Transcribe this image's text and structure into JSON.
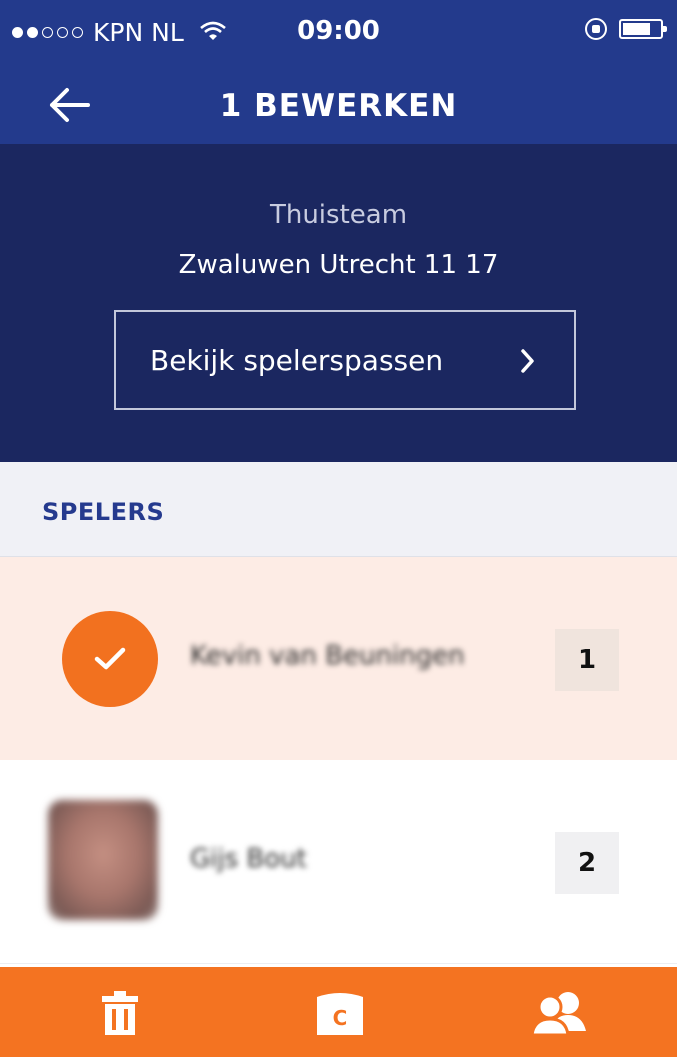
{
  "status_bar": {
    "carrier": "KPN NL",
    "time": "09:00",
    "signal_bars_filled": 2,
    "signal_bars_total": 5
  },
  "nav": {
    "title": "1 BEWERKEN",
    "back_icon": "arrow-left-icon"
  },
  "team": {
    "label": "Thuisteam",
    "name": "Zwaluwen Utrecht 11 17",
    "passes_button": "Bekijk spelerspassen"
  },
  "section": {
    "title": "SPELERS"
  },
  "players": [
    {
      "name": "Kevin van Beuningen",
      "number": "1",
      "selected": true
    },
    {
      "name": "Gijs Bout",
      "number": "2",
      "selected": false
    }
  ],
  "toolbar": {
    "icons": [
      "trash-icon",
      "card-icon",
      "users-icon"
    ],
    "card_letter": "C"
  },
  "colors": {
    "nav_blue": "#233a8c",
    "header_navy": "#1b2760",
    "accent_orange": "#f47321",
    "selected_row": "#fdece5",
    "section_title": "#253a8e"
  }
}
